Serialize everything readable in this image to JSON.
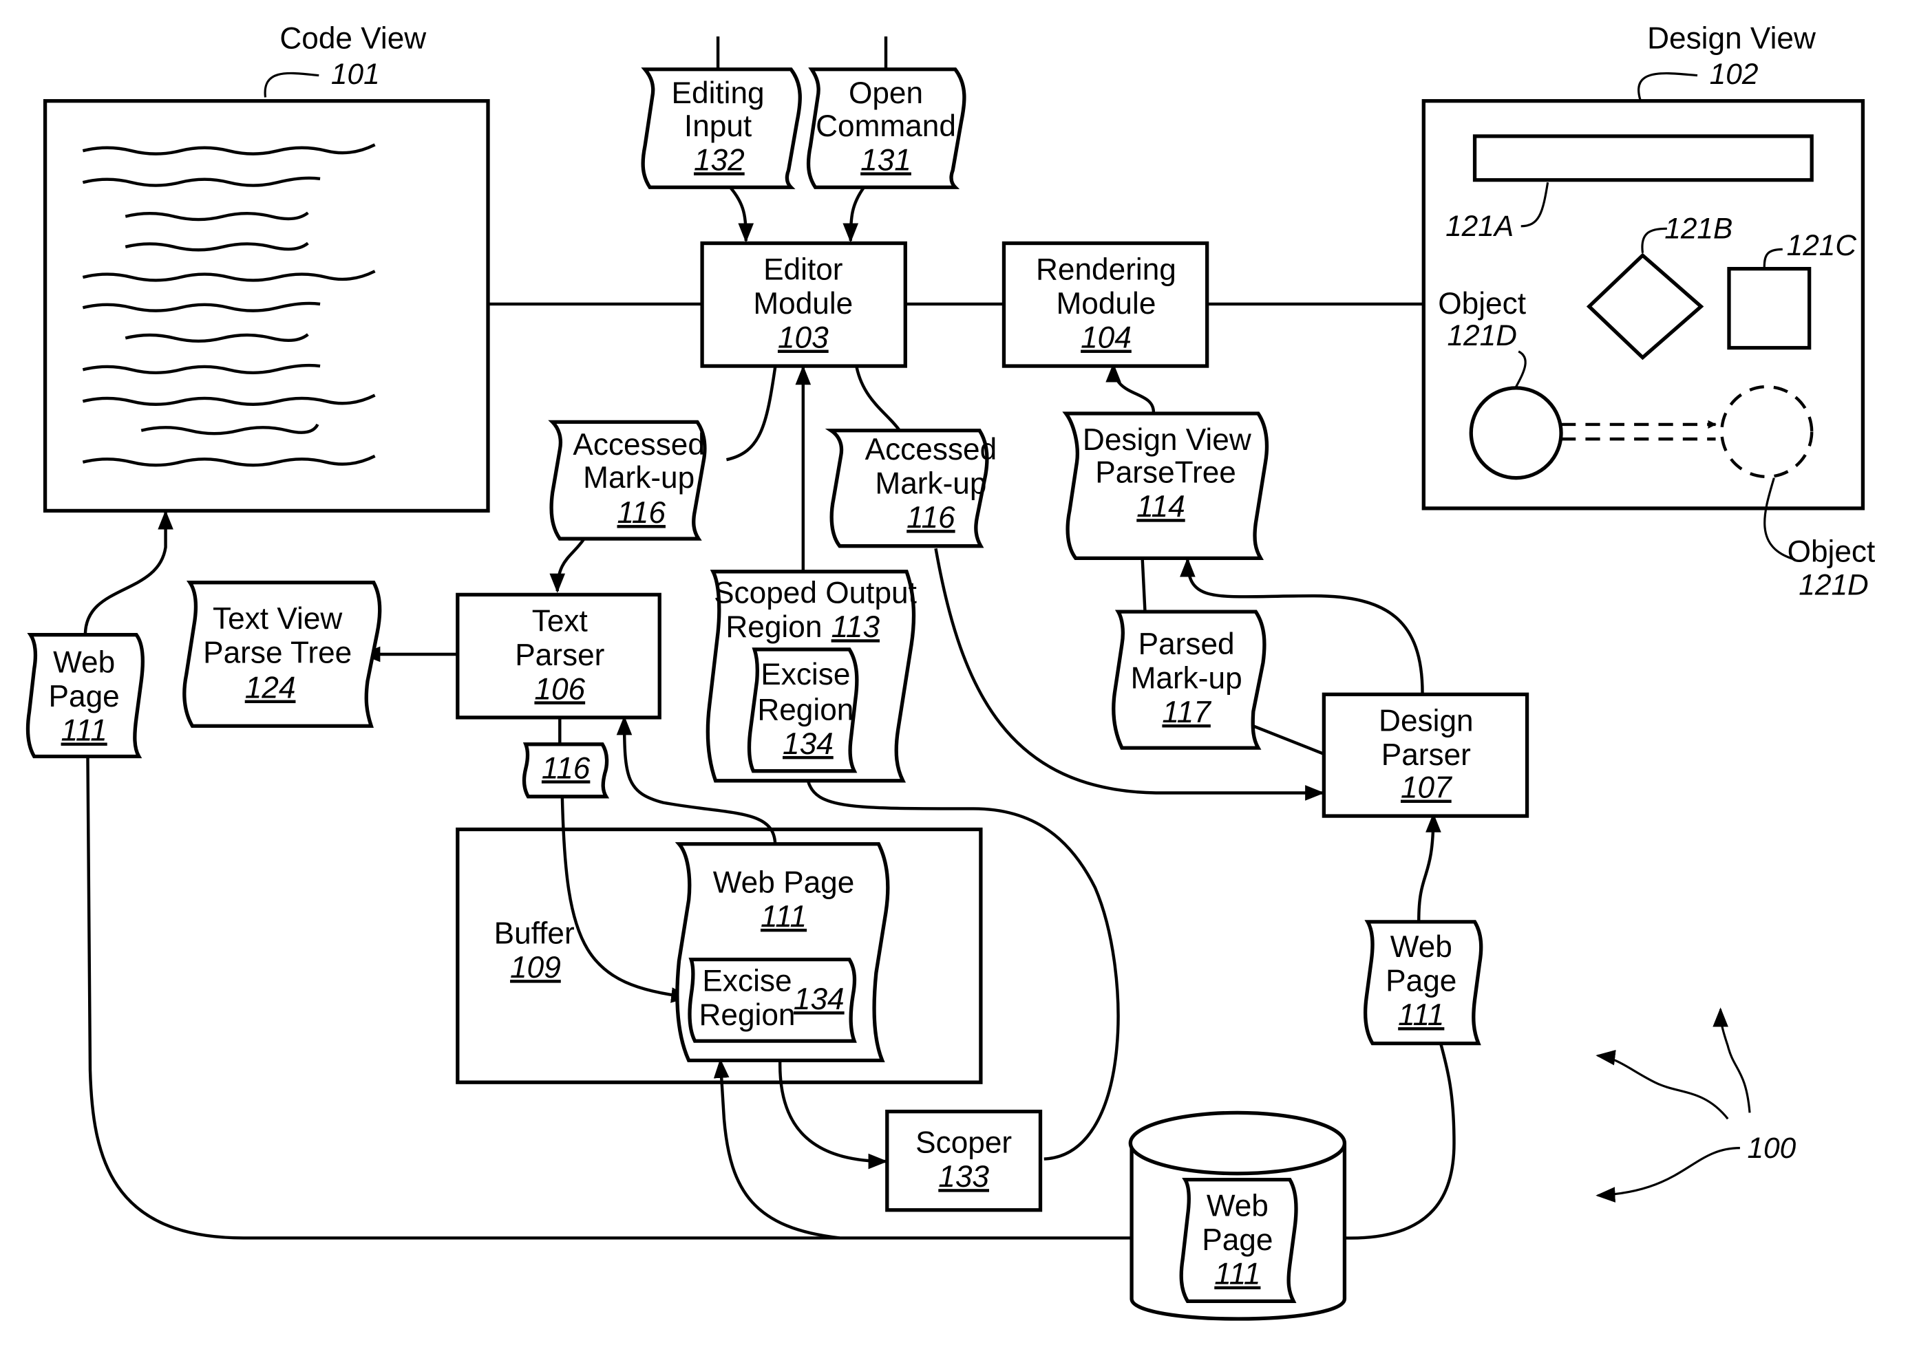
{
  "figure": {
    "reference": "100",
    "colors": {
      "stroke": "#000000",
      "background": "#ffffff"
    }
  },
  "code_view": {
    "title": "Code View",
    "ref": "101"
  },
  "design_view": {
    "title": "Design View",
    "ref": "102",
    "objects": [
      {
        "label": "121A"
      },
      {
        "label": "121B"
      },
      {
        "label": "121C"
      },
      {
        "label": "Object",
        "ref": "121D"
      },
      {
        "label": "Object",
        "ref": "121D"
      }
    ]
  },
  "inputs": {
    "editing_input": {
      "line1": "Editing",
      "line2": "Input",
      "ref": "132"
    },
    "open_command": {
      "line1": "Open",
      "line2": "Command",
      "ref": "131"
    }
  },
  "modules": {
    "editor": {
      "line1": "Editor",
      "line2": "Module",
      "ref": "103"
    },
    "rendering": {
      "line1": "Rendering",
      "line2": "Module",
      "ref": "104"
    },
    "text_parser": {
      "line1": "Text",
      "line2": "Parser",
      "ref": "106"
    },
    "design_parser": {
      "line1": "Design",
      "line2": "Parser",
      "ref": "107"
    },
    "scoper": {
      "line1": "Scoper",
      "ref": "133"
    },
    "buffer": {
      "line1": "Buffer",
      "ref": "109"
    }
  },
  "documents": {
    "accessed_markup_left": {
      "line1": "Accessed",
      "line2": "Mark-up",
      "ref": "116"
    },
    "accessed_markup_right": {
      "line1": "Accessed",
      "line2": "Mark-up",
      "ref": "116"
    },
    "accessed_markup_small": {
      "ref": "116"
    },
    "design_view_parsetree": {
      "line1": "Design View",
      "line2": "ParseTree",
      "ref": "114"
    },
    "text_view_parse_tree": {
      "line1": "Text View",
      "line2": "Parse Tree",
      "ref": "124"
    },
    "scoped_output_region": {
      "line1": "Scoped Output",
      "line2": "Region",
      "ref": "113"
    },
    "excise_region_scoped": {
      "line1": "Excise",
      "line2": "Region",
      "ref": "134"
    },
    "parsed_markup": {
      "line1": "Parsed",
      "line2": "Mark-up",
      "ref": "117"
    },
    "web_page_left": {
      "line1": "Web",
      "line2": "Page",
      "ref": "111"
    },
    "web_page_buffer": {
      "line1": "Web Page",
      "ref": "111"
    },
    "excise_region_buffer": {
      "line1": "Excise",
      "line2": "Region",
      "ref": "134"
    },
    "web_page_right": {
      "line1": "Web",
      "line2": "Page",
      "ref": "111"
    },
    "web_page_db": {
      "line1": "Web",
      "line2": "Page",
      "ref": "111"
    }
  }
}
